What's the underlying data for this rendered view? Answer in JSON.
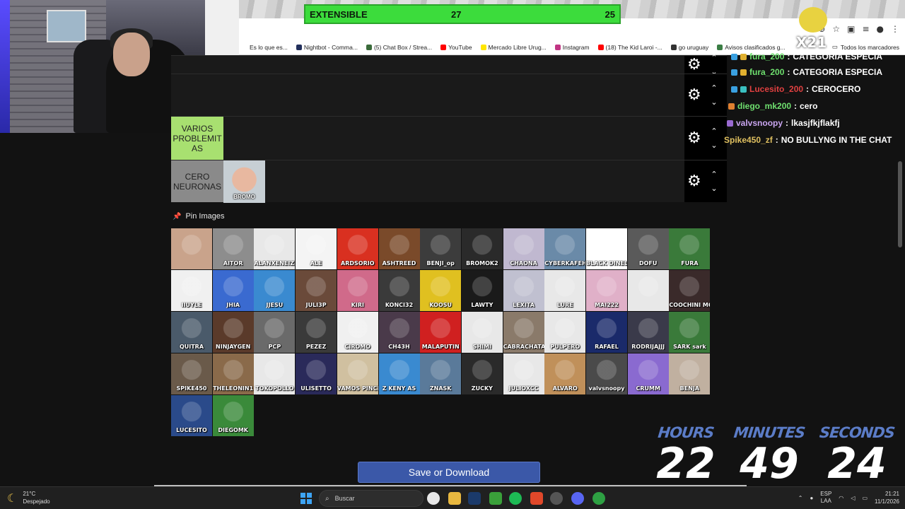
{
  "browser": {
    "bookmarks": [
      {
        "label": "Es lo que es...",
        "color": "#ffffff"
      },
      {
        "label": "Nightbot - Comma...",
        "color": "#222f5c"
      },
      {
        "label": "(5) Chat Box / Strea...",
        "color": "#3a6b3a"
      },
      {
        "label": "YouTube",
        "color": "#ff0000"
      },
      {
        "label": "Mercado Libre Urug...",
        "color": "#ffe600"
      },
      {
        "label": "Instagram",
        "color": "#c13584"
      },
      {
        "label": "(18) The Kid Laroi -...",
        "color": "#ff0000"
      },
      {
        "label": "go uruguay",
        "color": "#333333"
      },
      {
        "label": "Avisos clasificados g...",
        "color": "#3a7d44"
      }
    ],
    "all_bookmarks": "Todos los marcadores"
  },
  "poll": {
    "option": "EXTENSIBLE",
    "count_a": "27",
    "count_b": "25"
  },
  "sticker": {
    "text": "X21"
  },
  "tiers": [
    {
      "label": "",
      "color": "#1a1a1a",
      "items": []
    },
    {
      "label": "",
      "color": "#1a1a1a",
      "items": []
    },
    {
      "label": "VARIOS PROBLEMIT AS",
      "color": "#a8e070",
      "items": []
    },
    {
      "label": "CERO NEURONAS",
      "color": "#8a8a8a",
      "items": [
        {
          "caption": "BROMO"
        }
      ]
    }
  ],
  "chat": [
    {
      "user": "fura_200",
      "msg": "CATEGORIA ESPECIA",
      "color": "#6fe06f"
    },
    {
      "user": "fura_200",
      "msg": "CATEGORIA ESPECIA",
      "color": "#6fe06f"
    },
    {
      "user": "Lucesito_200",
      "msg": "CEROCERO",
      "color": "#e04040"
    },
    {
      "user": "diego_mk200",
      "msg": "cero",
      "color": "#6fe06f"
    },
    {
      "user": "valvsnoopy",
      "msg": "lkasjfkjflakfj",
      "color": "#c9a5f0"
    },
    {
      "user": "Spike450_zf",
      "msg": "NO BULLYNG IN THE CHAT",
      "color": "#e0c060"
    }
  ],
  "pin_title": "Pin Images",
  "images": [
    {
      "caption": "",
      "bg": "#c9a38b"
    },
    {
      "caption": "AITOR",
      "bg": "#8d8d8d"
    },
    {
      "caption": "ALANXENEIZE",
      "bg": "#e8e8e8"
    },
    {
      "caption": "ALE",
      "bg": "#f4f4f4"
    },
    {
      "caption": "ARDSORIO",
      "bg": "#d93020"
    },
    {
      "caption": "ASHTREED",
      "bg": "#7a4a2a"
    },
    {
      "caption": "BENJI_op",
      "bg": "#3c3c3c"
    },
    {
      "caption": "BROMOK2",
      "bg": "#2a2a2a"
    },
    {
      "caption": "CHAONA",
      "bg": "#c0b8d0"
    },
    {
      "caption": "CYBERKAFEH",
      "bg": "#6a8aa8"
    },
    {
      "caption": "BLACK DINELLA",
      "bg": "#ffffff"
    },
    {
      "caption": "DOFU",
      "bg": "#5a5a5a"
    },
    {
      "caption": "FURA",
      "bg": "#3a7a3a"
    },
    {
      "caption": "IIUYLE",
      "bg": "#f0f0f0"
    },
    {
      "caption": "JHIA",
      "bg": "#3a6ad0"
    },
    {
      "caption": "JJESU",
      "bg": "#3a8ad0"
    },
    {
      "caption": "JULI3P",
      "bg": "#6a4a3a"
    },
    {
      "caption": "KIRI",
      "bg": "#d06a8a"
    },
    {
      "caption": "KONCI32",
      "bg": "#3a3a3a"
    },
    {
      "caption": "KOOSU",
      "bg": "#e0c020"
    },
    {
      "caption": "LAWTY",
      "bg": "#1a1a1a"
    },
    {
      "caption": "LEXITA",
      "bg": "#c0c0d0"
    },
    {
      "caption": "LURE",
      "bg": "#e8e8e8"
    },
    {
      "caption": "MAI222",
      "bg": "#e0b0c8"
    },
    {
      "caption": "",
      "bg": "#e8e8e8"
    },
    {
      "caption": "COOCHINI MOCHINICAY",
      "bg": "#3a2a2a"
    },
    {
      "caption": "QUITRA",
      "bg": "#4a5a6a"
    },
    {
      "caption": "NINJAYGEN",
      "bg": "#5a3a2a"
    },
    {
      "caption": "PCP",
      "bg": "#6a6a6a"
    },
    {
      "caption": "PEZEZ",
      "bg": "#3a3a3a"
    },
    {
      "caption": "CIROMO",
      "bg": "#f0f0f0"
    },
    {
      "caption": "CH43H",
      "bg": "#4a3a4a"
    },
    {
      "caption": "MALAPUTIN",
      "bg": "#d02020"
    },
    {
      "caption": "SHIMI",
      "bg": "#e8e8e8"
    },
    {
      "caption": "CABRACHATA",
      "bg": "#8a7a6a"
    },
    {
      "caption": "PULPERO",
      "bg": "#e8e8e8"
    },
    {
      "caption": "RAFAEL",
      "bg": "#1a2a6a"
    },
    {
      "caption": "RODRIJAJJJ",
      "bg": "#3a3a4a"
    },
    {
      "caption": "SARK sark",
      "bg": "#3a7a3a"
    },
    {
      "caption": "SPIKE450",
      "bg": "#6a5a4a"
    },
    {
      "caption": "THELEONIN1",
      "bg": "#8a6a4a"
    },
    {
      "caption": "TOKOPOLLO",
      "bg": "#e8e8e8"
    },
    {
      "caption": "ULISETTO",
      "bg": "#2a2a5a"
    },
    {
      "caption": "VAMOS PINCHA",
      "bg": "#d0c0a0"
    },
    {
      "caption": "Z KENY AS",
      "bg": "#3a8ad0"
    },
    {
      "caption": "ZNASK",
      "bg": "#5a7a9a"
    },
    {
      "caption": "ZUCKY",
      "bg": "#2a2a2a"
    },
    {
      "caption": "JULIOXCC",
      "bg": "#e8e8e8"
    },
    {
      "caption": "ALVARO",
      "bg": "#c0905a"
    },
    {
      "caption": "valvsnoopy",
      "bg": "#4a4a4a"
    },
    {
      "caption": "CRUMM",
      "bg": "#8a6ad0"
    },
    {
      "caption": "BENJA",
      "bg": "#c0b0a0"
    },
    {
      "caption": "LUCESITO",
      "bg": "#2a4a8a"
    },
    {
      "caption": "DIEGOMK",
      "bg": "#3a8a3a"
    }
  ],
  "timer": {
    "hours_label": "HOURS",
    "hours": "22",
    "minutes_label": "MINUTES",
    "minutes": "49",
    "seconds_label": "SECONDS",
    "seconds": "24"
  },
  "save_button": "Save or Download",
  "taskbar": {
    "temperature": "21°C",
    "weather": "Despejado",
    "search_placeholder": "Buscar",
    "lang_1": "ESP",
    "lang_2": "LAA",
    "time": "21:21",
    "date": "11/1/2026"
  }
}
